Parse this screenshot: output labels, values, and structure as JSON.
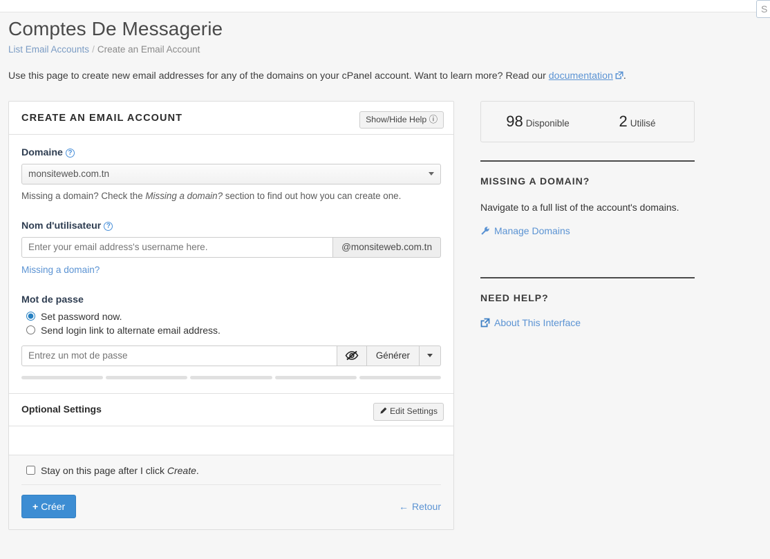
{
  "topbar": {
    "search_value": "S",
    "search_placeholder": "Search"
  },
  "header": {
    "title": "Comptes De Messagerie",
    "breadcrumb": {
      "link_label": "List Email Accounts",
      "separator": "/",
      "current": "Create an Email Account"
    },
    "lead_before": "Use this page to create new email addresses for any of the domains on your cPanel account. Want to learn more? Read our ",
    "lead_link": "documentation",
    "lead_after": "."
  },
  "form": {
    "card_title": "CREATE AN EMAIL ACCOUNT",
    "help_button": "Show/Hide Help",
    "help_icon": "question-circle-icon",
    "domain": {
      "label": "Domaine",
      "help_icon": "question-circle-icon",
      "selected": "monsiteweb.com.tn",
      "options": [
        "monsiteweb.com.tn"
      ],
      "helper_before": "Missing a domain? Check the ",
      "helper_em": "Missing a domain?",
      "helper_after": " section to find out how you can create one."
    },
    "username": {
      "label": "Nom d'utilisateur",
      "help_icon": "question-circle-icon",
      "value": "",
      "placeholder": "Enter your email address's username here.",
      "addon": "@monsiteweb.com.tn",
      "missing_domain_link": "Missing a domain?"
    },
    "password": {
      "label": "Mot de passe",
      "option_set_now": "Set password now.",
      "option_send_link": "Send login link to alternate email address.",
      "selected_option": "set_now",
      "value": "",
      "placeholder": "Entrez un mot de passe",
      "toggle_icon": "eye-slash-icon",
      "generate_label": "Générer",
      "caret_icon": "chevron-down-icon",
      "strength_segments": 5,
      "strength_filled": 0
    },
    "optional": {
      "title": "Optional Settings",
      "edit_button": "Edit Settings",
      "edit_icon": "pencil-icon"
    },
    "footer": {
      "stay_checkbox_before": "Stay on this page after I click ",
      "stay_checkbox_em": "Create",
      "stay_checkbox_after": ".",
      "stay_checked": false,
      "create_button": "Créer",
      "create_icon": "plus-icon",
      "back_link": "Retour",
      "back_icon": "arrow-left-icon"
    }
  },
  "sidebar": {
    "stats": [
      {
        "number": "98",
        "label": "Disponible"
      },
      {
        "number": "2",
        "label": "Utilisé"
      }
    ],
    "missing_domain": {
      "title": "MISSING A DOMAIN?",
      "text": "Navigate to a full list of the account's domains.",
      "link": "Manage Domains",
      "link_icon": "wrench-icon"
    },
    "need_help": {
      "title": "NEED HELP?",
      "link": "About This Interface",
      "link_icon": "external-link-icon"
    }
  },
  "colors": {
    "primary": "#3d8dd3",
    "link": "#5b93d3",
    "text": "#333333",
    "muted": "#8a8a8a",
    "border": "#dddddd",
    "page_bg": "#f6f6f6"
  }
}
